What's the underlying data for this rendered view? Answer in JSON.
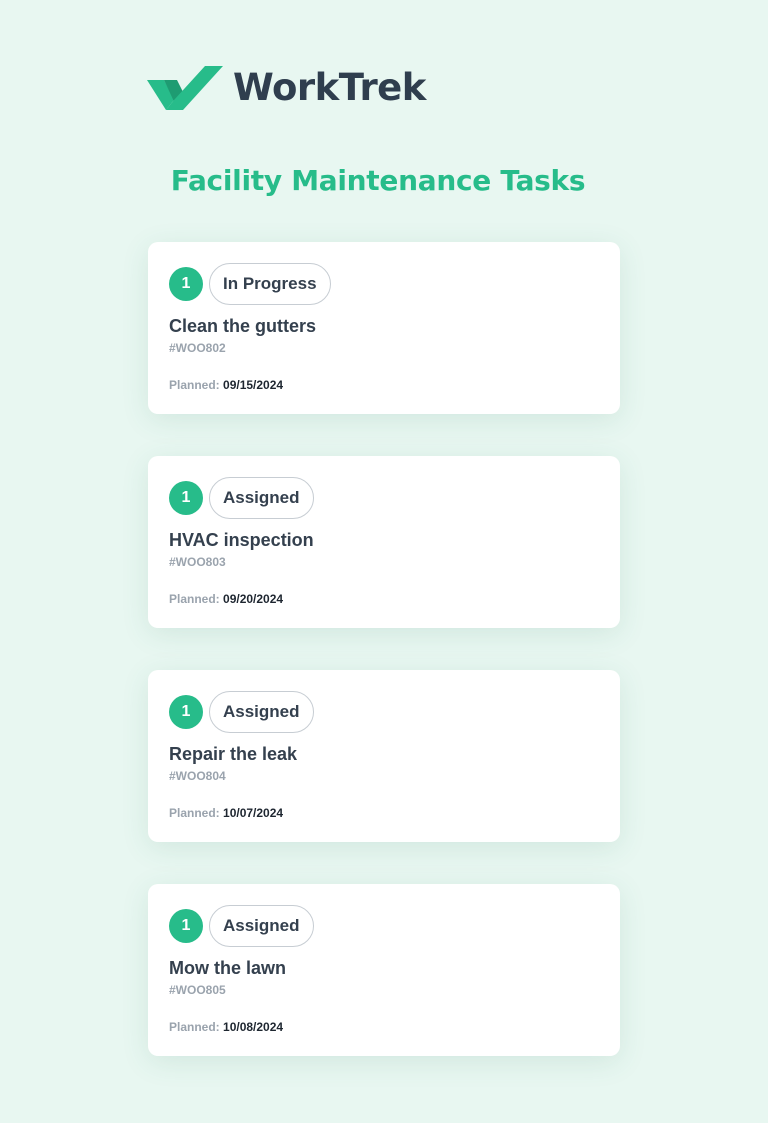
{
  "brand": {
    "name": "WorkTrek",
    "accent": "#27bc8a",
    "text_color": "#2f3e4e",
    "logo_icon": "double-check-icon"
  },
  "page_title": "Facility Maintenance Tasks",
  "tasks": [
    {
      "number": "1",
      "status": "In Progress",
      "title": "Clean the gutters",
      "id": "#WOO802",
      "planned_label": "Planned:",
      "planned_date": "09/15/2024"
    },
    {
      "number": "1",
      "status": "Assigned",
      "title": "HVAC inspection",
      "id": "#WOO803",
      "planned_label": "Planned:",
      "planned_date": "09/20/2024"
    },
    {
      "number": "1",
      "status": "Assigned",
      "title": "Repair the leak",
      "id": "#WOO804",
      "planned_label": "Planned:",
      "planned_date": "10/07/2024"
    },
    {
      "number": "1",
      "status": "Assigned",
      "title": "Mow the lawn",
      "id": "#WOO805",
      "planned_label": "Planned:",
      "planned_date": "10/08/2024"
    }
  ]
}
